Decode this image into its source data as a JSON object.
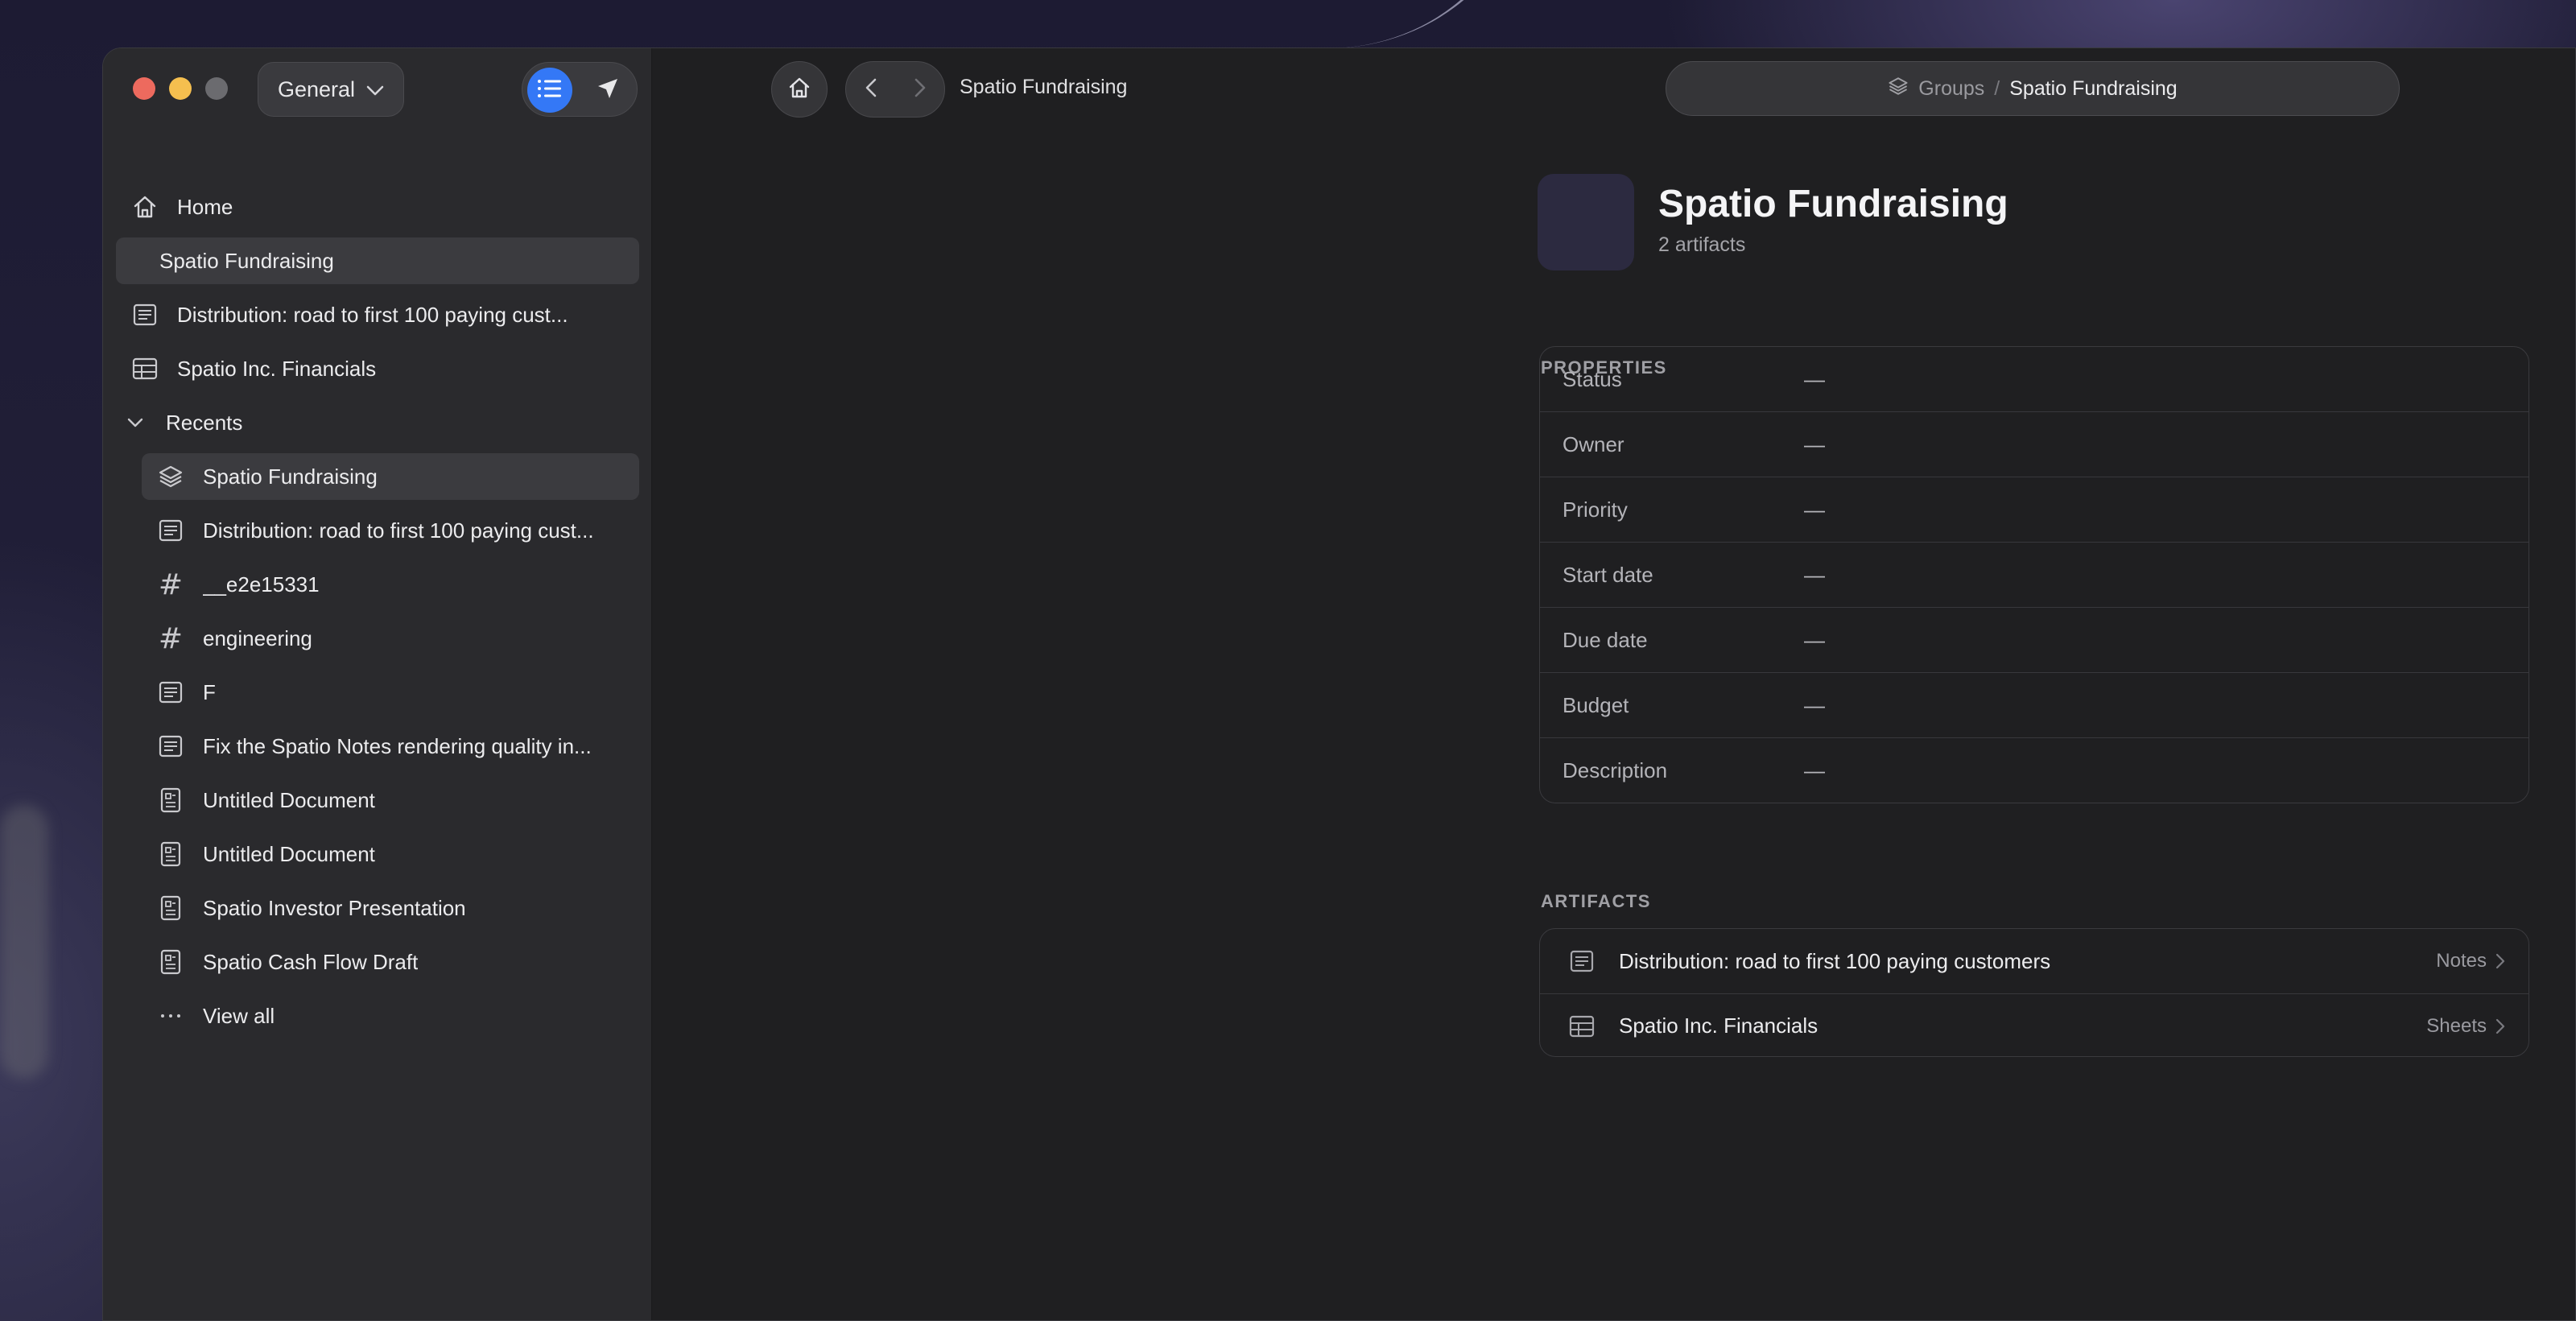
{
  "sidebar": {
    "space_label": "General",
    "items": [
      {
        "label": "Home",
        "icon": "home-icon"
      },
      {
        "label": "Spatio Fundraising",
        "icon": "none"
      },
      {
        "label": "Distribution: road to first 100 paying cust...",
        "icon": "document-icon"
      },
      {
        "label": "Spatio Inc. Financials",
        "icon": "table-icon"
      }
    ],
    "recents_label": "Recents",
    "recents": [
      {
        "label": "Spatio Fundraising",
        "icon": "layers-icon"
      },
      {
        "label": "Distribution: road to first 100 paying cust...",
        "icon": "document-icon"
      },
      {
        "label": "__e2e15331",
        "icon": "hash-icon"
      },
      {
        "label": "engineering",
        "icon": "hash-icon"
      },
      {
        "label": "F",
        "icon": "document-icon"
      },
      {
        "label": "Fix the Spatio Notes rendering quality in...",
        "icon": "document-icon"
      },
      {
        "label": "Untitled Document",
        "icon": "presentation-icon"
      },
      {
        "label": "Untitled Document",
        "icon": "presentation-icon"
      },
      {
        "label": "Spatio Investor Presentation",
        "icon": "presentation-icon"
      },
      {
        "label": "Spatio Cash Flow Draft",
        "icon": "presentation-icon"
      }
    ],
    "view_all_label": "View all"
  },
  "toolbar": {
    "title": "Spatio Fundraising",
    "breadcrumb": {
      "root": "Groups",
      "separator": "/",
      "current": "Spatio Fundraising"
    }
  },
  "main": {
    "title": "Spatio Fundraising",
    "subtitle": "2 artifacts",
    "properties_label": "PROPERTIES",
    "properties": [
      {
        "name": "Status",
        "value": "—"
      },
      {
        "name": "Owner",
        "value": "—"
      },
      {
        "name": "Priority",
        "value": "—"
      },
      {
        "name": "Start date",
        "value": "—"
      },
      {
        "name": "Due date",
        "value": "—"
      },
      {
        "name": "Budget",
        "value": "—"
      },
      {
        "name": "Description",
        "value": "—"
      }
    ],
    "artifacts_label": "ARTIFACTS",
    "artifacts": [
      {
        "name": "Distribution: road to first 100 paying customers",
        "type": "Notes",
        "icon": "document-icon"
      },
      {
        "name": "Spatio Inc. Financials",
        "type": "Sheets",
        "icon": "table-icon"
      }
    ]
  },
  "colors": {
    "accent": "#3478f6",
    "close": "#ed6a5e",
    "minimize": "#f5bf4f"
  }
}
